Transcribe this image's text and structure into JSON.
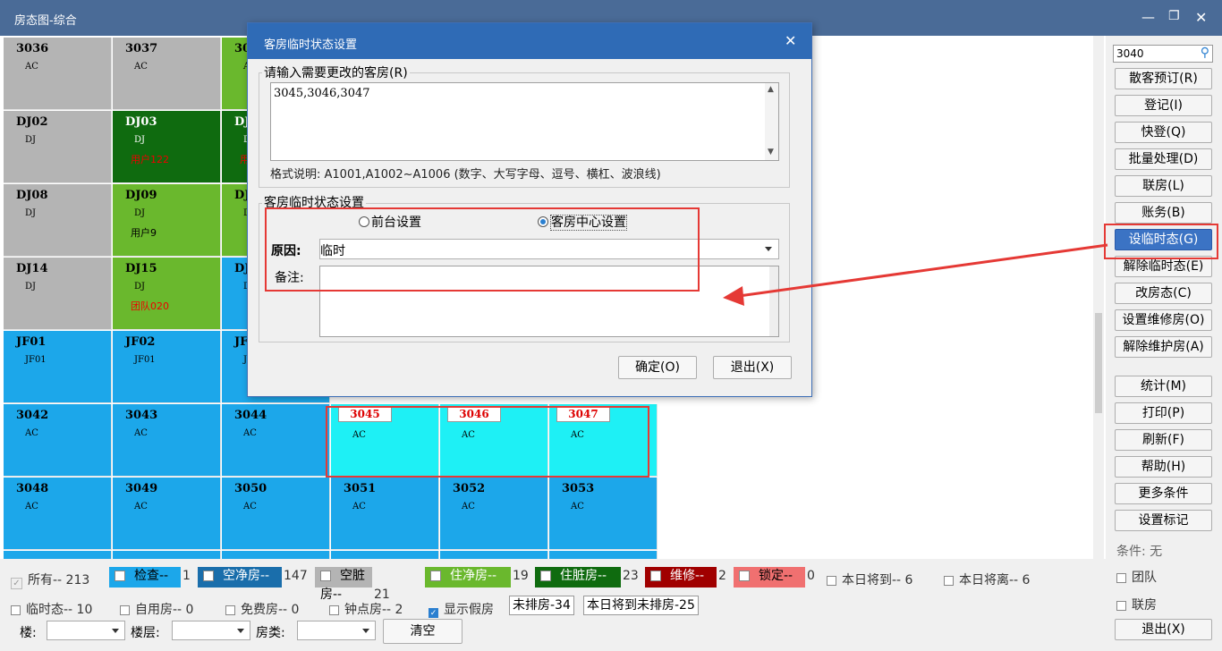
{
  "window": {
    "title": "房态图-综合"
  },
  "rooms": [
    {
      "no": "3036",
      "type": "AC",
      "guest": "",
      "color": "#b4b4b4",
      "col": 0,
      "row": 0
    },
    {
      "no": "3037",
      "type": "AC",
      "guest": "",
      "color": "#b4b4b4",
      "col": 1,
      "row": 0
    },
    {
      "no": "30",
      "type": "A",
      "guest": "",
      "color": "#6ab82d",
      "col": 2,
      "row": 0
    },
    {
      "no": "DJ02",
      "type": "DJ",
      "guest": "",
      "color": "#b4b4b4",
      "col": 0,
      "row": 1
    },
    {
      "no": "DJ03",
      "type": "DJ",
      "guest": "用户122",
      "color": "#0f6b0f",
      "col": 1,
      "row": 1
    },
    {
      "no": "DJ",
      "type": "D",
      "guest": "用",
      "color": "#0f6b0f",
      "col": 2,
      "row": 1
    },
    {
      "no": "DJ08",
      "type": "DJ",
      "guest": "",
      "color": "#b4b4b4",
      "col": 0,
      "row": 2
    },
    {
      "no": "DJ09",
      "type": "DJ",
      "guest": "用户9",
      "color": "#6ab82d",
      "col": 1,
      "row": 2
    },
    {
      "no": "DJ",
      "type": "D",
      "guest": "",
      "color": "#6ab82d",
      "col": 2,
      "row": 2
    },
    {
      "no": "DJ14",
      "type": "DJ",
      "guest": "",
      "color": "#b4b4b4",
      "col": 0,
      "row": 3
    },
    {
      "no": "DJ15",
      "type": "DJ",
      "guest": "团队020",
      "color": "#6ab82d",
      "col": 1,
      "row": 3
    },
    {
      "no": "DJ",
      "type": "D",
      "guest": "",
      "color": "#1ca7ea",
      "col": 2,
      "row": 3
    },
    {
      "no": "JF01",
      "type": "JF01",
      "guest": "",
      "color": "#1ca7ea",
      "col": 0,
      "row": 4
    },
    {
      "no": "JF02",
      "type": "JF01",
      "guest": "",
      "color": "#1ca7ea",
      "col": 1,
      "row": 4
    },
    {
      "no": "JF",
      "type": "JF",
      "guest": "",
      "color": "#1ca7ea",
      "col": 2,
      "row": 4
    },
    {
      "no": "3042",
      "type": "AC",
      "guest": "",
      "color": "#1ca7ea",
      "col": 0,
      "row": 5
    },
    {
      "no": "3043",
      "type": "AC",
      "guest": "",
      "color": "#1ca7ea",
      "col": 1,
      "row": 5
    },
    {
      "no": "3044",
      "type": "AC",
      "guest": "",
      "color": "#1ca7ea",
      "col": 2,
      "row": 5
    },
    {
      "no": "3045",
      "type": "AC",
      "guest": "",
      "color": "#1ef0f5",
      "col": 3,
      "row": 5,
      "tag": true
    },
    {
      "no": "3046",
      "type": "AC",
      "guest": "",
      "color": "#1ef0f5",
      "col": 4,
      "row": 5,
      "tag": true
    },
    {
      "no": "3047",
      "type": "AC",
      "guest": "",
      "color": "#1ef0f5",
      "col": 5,
      "row": 5,
      "tag": true
    },
    {
      "no": "3048",
      "type": "AC",
      "guest": "",
      "color": "#1ca7ea",
      "col": 0,
      "row": 6
    },
    {
      "no": "3049",
      "type": "AC",
      "guest": "",
      "color": "#1ca7ea",
      "col": 1,
      "row": 6
    },
    {
      "no": "3050",
      "type": "AC",
      "guest": "",
      "color": "#1ca7ea",
      "col": 2,
      "row": 6
    },
    {
      "no": "3051",
      "type": "AC",
      "guest": "",
      "color": "#1ca7ea",
      "col": 3,
      "row": 6
    },
    {
      "no": "3052",
      "type": "AC",
      "guest": "",
      "color": "#1ca7ea",
      "col": 4,
      "row": 6
    },
    {
      "no": "3053",
      "type": "AC",
      "guest": "",
      "color": "#1ca7ea",
      "col": 5,
      "row": 6
    },
    {
      "no": "",
      "type": "",
      "guest": "",
      "color": "#1ca7ea",
      "col": 0,
      "row": 7
    },
    {
      "no": "",
      "type": "",
      "guest": "",
      "color": "#1ca7ea",
      "col": 1,
      "row": 7
    },
    {
      "no": "",
      "type": "",
      "guest": "",
      "color": "#1ca7ea",
      "col": 2,
      "row": 7
    },
    {
      "no": "",
      "type": "",
      "guest": "",
      "color": "#1ca7ea",
      "col": 3,
      "row": 7
    },
    {
      "no": "",
      "type": "",
      "guest": "",
      "color": "#1ca7ea",
      "col": 4,
      "row": 7
    },
    {
      "no": "",
      "type": "",
      "guest": "",
      "color": "#1ca7ea",
      "col": 5,
      "row": 7
    }
  ],
  "side": {
    "search_value": "3040",
    "buttons": [
      "散客预订(R)",
      "登记(I)",
      "快登(Q)",
      "批量处理(D)",
      "联房(L)",
      "账务(B)",
      "设临时态(G)",
      "解除临时态(E)",
      "改房态(C)",
      "设置维修房(O)",
      "解除维护房(A)",
      "统计(M)",
      "打印(P)",
      "刷新(F)",
      "帮助(H)",
      "更多条件",
      "设置标记",
      "退出(X)"
    ],
    "condition_label": "条件: 无",
    "team_label": "团队",
    "linked_label": "联房"
  },
  "legend": {
    "all": "所有-- 213",
    "chips": [
      {
        "label": "检查--",
        "count": "1",
        "color": "#1ca7ea",
        "text": "#000"
      },
      {
        "label": "空净房--",
        "count": "147",
        "color": "#1a6eab",
        "text": "#fff"
      },
      {
        "label": "空脏房--",
        "count": "21",
        "color": "#b4b4b4",
        "text": "#000"
      },
      {
        "label": "住净房--",
        "count": "19",
        "color": "#6ab82d",
        "text": "#fff"
      },
      {
        "label": "住脏房--",
        "count": "23",
        "color": "#0f6b0f",
        "text": "#fff"
      },
      {
        "label": "维修--",
        "count": "2",
        "color": "#a00000",
        "text": "#fff"
      },
      {
        "label": "锁定--",
        "count": "0",
        "color": "#f07070",
        "text": "#000"
      }
    ],
    "arrive_today": "本日将到-- 6",
    "leave_today": "本日将离-- 6",
    "temp": "临时态-- 10",
    "self_use": "自用房-- 0",
    "free": "免费房-- 0",
    "hourly": "钟点房-- 2",
    "show_fake": "显示假房",
    "unassigned": "未排房-34",
    "arrive_unassigned": "本日将到未排房-25",
    "building_label": "楼:",
    "floor_label": "楼层:",
    "roomtype_label": "房类:",
    "clear_button": "清空"
  },
  "dialog": {
    "title": "客房临时状态设置",
    "rooms_legend": "请输入需要更改的客房(R)",
    "rooms_value": "3045,3046,3047",
    "format_hint": "格式说明: A1001,A1002~A1006 (数字、大写字母、逗号、横杠、波浪线)",
    "status_legend": "客房临时状态设置",
    "radio_front": "前台设置",
    "radio_center": "客房中心设置",
    "reason_label": "原因:",
    "reason_value": "临时",
    "note_label": "备注:",
    "ok_button": "确定(O)",
    "exit_button": "退出(X)"
  }
}
